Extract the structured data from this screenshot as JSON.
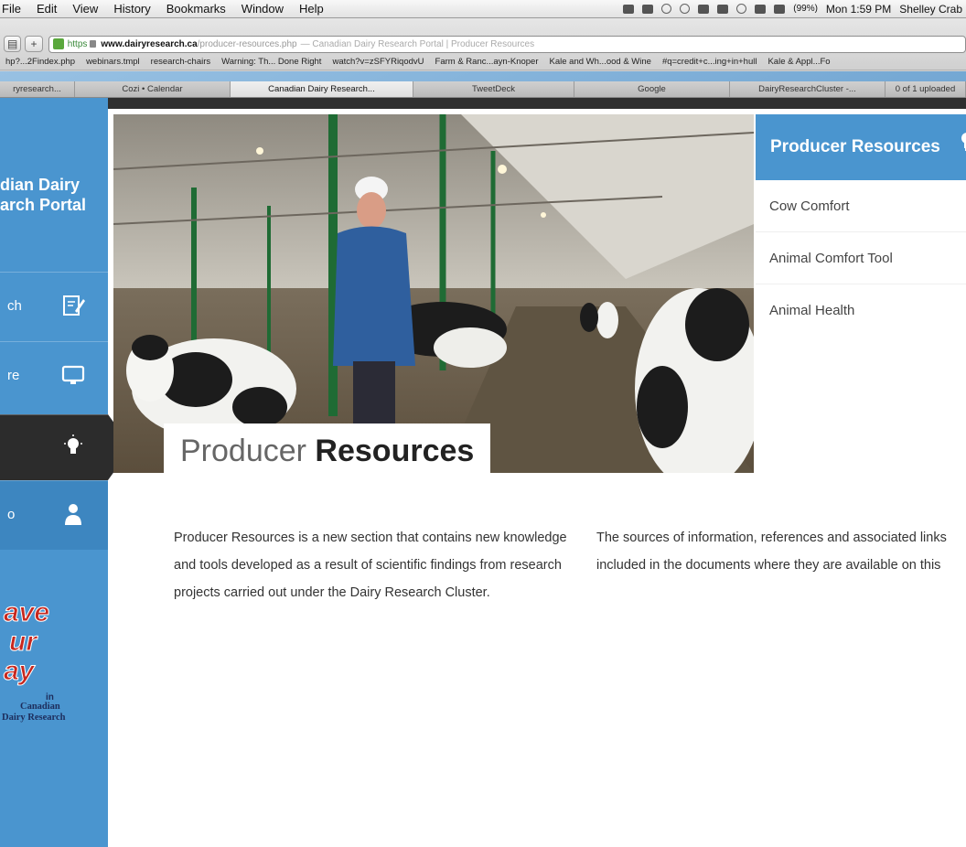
{
  "menubar": {
    "items": [
      "File",
      "Edit",
      "View",
      "History",
      "Bookmarks",
      "Window",
      "Help"
    ],
    "battery": "(99%)",
    "clock": "Mon 1:59 PM",
    "user": "Shelley Crab"
  },
  "browser": {
    "url_scheme": "https",
    "url_domain": "www.dairyresearch.ca",
    "url_path": "/producer-resources.php",
    "page_title": "— Canadian Dairy Research Portal | Producer Resources",
    "bookmarks": [
      "hp?...2Findex.php",
      "webinars.tmpl",
      "research-chairs",
      "Warning: Th... Done Right",
      "watch?v=zSFYRiqodvU",
      "Farm & Ranc...ayn-Knoper",
      "Kale and Wh...ood & Wine",
      "#q=credit+c...ing+in+hull",
      "Kale & Appl...Fo"
    ],
    "tabs": [
      "ryresearch...",
      "Cozi • Calendar",
      "Canadian Dairy Research...",
      "TweetDeck",
      "Google",
      "DairyResearchCluster -...",
      "0 of 1 uploaded"
    ]
  },
  "sidebar": {
    "title_line1": "dian Dairy",
    "title_line2": "arch Portal",
    "items": [
      {
        "label": "ch"
      },
      {
        "label": "re"
      },
      {
        "label": ""
      },
      {
        "label": "o"
      }
    ],
    "badge": {
      "words": [
        "ave",
        "ur",
        "ay"
      ],
      "in": "in",
      "sub_line1": "Canadian",
      "sub_line2": "Dairy Research"
    }
  },
  "hero": {
    "title_light": "Producer",
    "title_bold": "Resources"
  },
  "right_panel": {
    "heading": "Producer Resources",
    "items": [
      "Cow Comfort",
      "Animal Comfort Tool",
      "Animal Health"
    ]
  },
  "content": {
    "left_paragraph": "Producer Resources is a new section that contains new knowledge and tools developed as a result of scientific findings from research projects carried out under the Dairy Research Cluster.",
    "right_paragraph_line1": "The sources of information, references and associated links",
    "right_paragraph_line2": "included in the documents where they are available on this"
  },
  "colors": {
    "brand_blue": "#4a95cf",
    "dark": "#2c2c2c",
    "badge_red": "#c7281f"
  }
}
